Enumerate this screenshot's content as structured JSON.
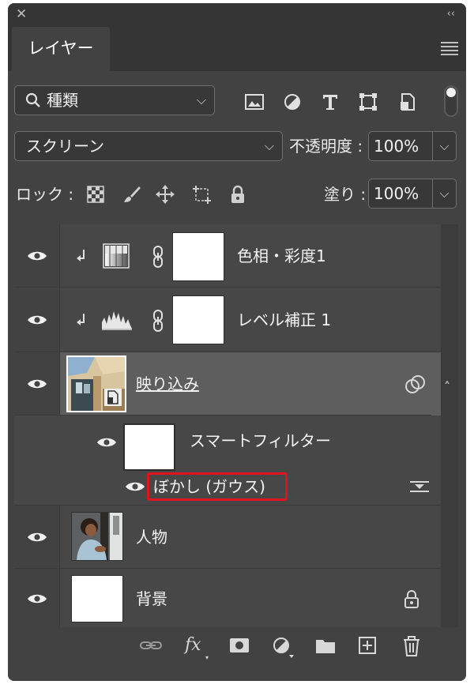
{
  "window": {
    "close_glyph": "✕",
    "collapse_glyph": "‹‹"
  },
  "panel": {
    "tab_label": "レイヤー",
    "menu_icon": "hamburger-menu-icon"
  },
  "filter": {
    "kind_label": "種類",
    "icons": [
      "image-filter-icon",
      "adjustment-filter-icon",
      "type-filter-icon",
      "shape-filter-icon",
      "smart-object-filter-icon"
    ]
  },
  "blend": {
    "mode": "スクリーン",
    "opacity_label": "不透明度 :",
    "opacity_value": "100%"
  },
  "lock": {
    "label": "ロック :",
    "icons": [
      "lock-transparent-pixels-icon",
      "lock-image-pixels-icon",
      "lock-position-icon",
      "lock-artboard-icon",
      "lock-all-icon"
    ],
    "fill_label": "塗り :",
    "fill_value": "100%"
  },
  "layers": [
    {
      "name": "色相・彩度1",
      "type": "hue-saturation",
      "clipped": true,
      "visible": true
    },
    {
      "name": "レベル補正 1",
      "type": "levels",
      "clipped": true,
      "visible": true
    },
    {
      "name": "映り込み",
      "type": "smart-object",
      "selected": true,
      "visible": true
    },
    {
      "name": "スマートフィルター",
      "type": "smart-filter",
      "visible": true
    },
    {
      "name": "ぼかし (ガウス)",
      "type": "filter",
      "visible": true,
      "highlight_color": "#e0141e"
    },
    {
      "name": "人物",
      "type": "pixel",
      "visible": true
    },
    {
      "name": "背景",
      "type": "background",
      "locked": true,
      "visible": true
    }
  ],
  "bottom_toolbar": [
    "link-layers-icon",
    "fx-icon",
    "add-mask-icon",
    "adjustment-layer-icon",
    "new-group-icon",
    "new-layer-icon",
    "trash-icon"
  ],
  "bottom_toolbar_labels": {
    "fx": "fx"
  },
  "colors": {
    "panel_bg": "#424242",
    "selected_row": "#5e5e5e",
    "highlight": "#e0141e"
  }
}
